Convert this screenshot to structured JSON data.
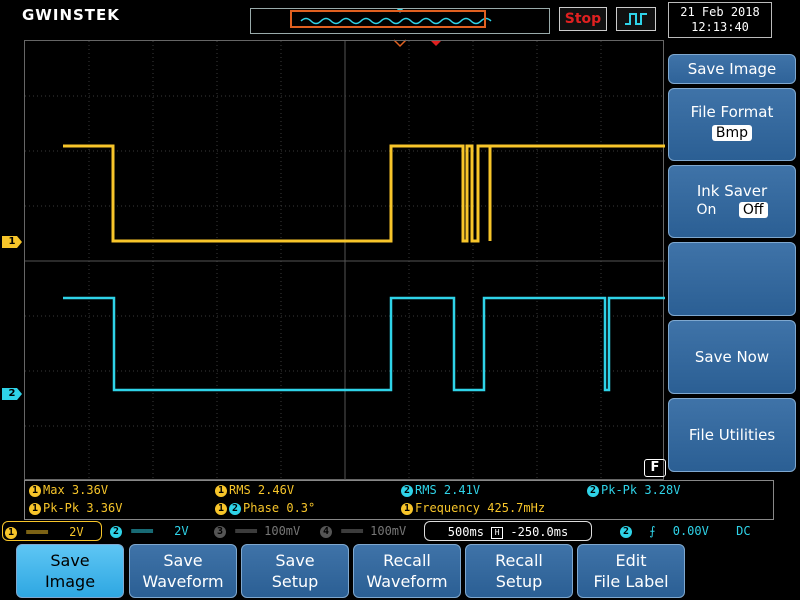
{
  "brand": "GWINSTEK",
  "run_state": "Stop",
  "datetime": {
    "date": "21 Feb 2018",
    "time": "12:13:40"
  },
  "markers": {
    "ch1": "1",
    "ch2": "2",
    "function_key": "F"
  },
  "side_menu": {
    "title": "Save Image",
    "file_format_label": "File Format",
    "file_format_value": "Bmp",
    "ink_saver_label": "Ink Saver",
    "ink_saver_on": "On",
    "ink_saver_off": "Off",
    "save_now": "Save Now",
    "file_utilities": "File Utilities"
  },
  "measurements": {
    "m1": {
      "label": "Max",
      "value": "3.36V"
    },
    "m2": {
      "label": "RMS",
      "value": "2.46V"
    },
    "m3": {
      "label": "RMS",
      "value": "2.41V"
    },
    "m4": {
      "label": "Pk-Pk",
      "value": "3.28V"
    },
    "m5": {
      "label": "Pk-Pk",
      "value": "3.36V"
    },
    "m6": {
      "label": "Phase",
      "value": "0.3°"
    },
    "m7": {
      "label": "Frequency",
      "value": "425.7mHz"
    }
  },
  "status": {
    "ch1_scale": "2V",
    "ch2_scale": "2V",
    "ch3_scale": "100mV",
    "ch4_scale": "100mV",
    "timebase": "500ms",
    "position": "-250.0ms",
    "trigger_level": "0.00V",
    "coupling": "DC"
  },
  "bottom_menu": {
    "b1": "Save\nImage",
    "b2": "Save\nWaveform",
    "b3": "Save\nSetup",
    "b4": "Recall\nWaveform",
    "b5": "Recall\nSetup",
    "b6": "Edit\nFile Label"
  },
  "colors": {
    "ch1": "#f7c52a",
    "ch2": "#2fd3e8",
    "menu_blue": "#3f73a8",
    "active": "#2ea7e2",
    "stop": "#e02020"
  }
}
